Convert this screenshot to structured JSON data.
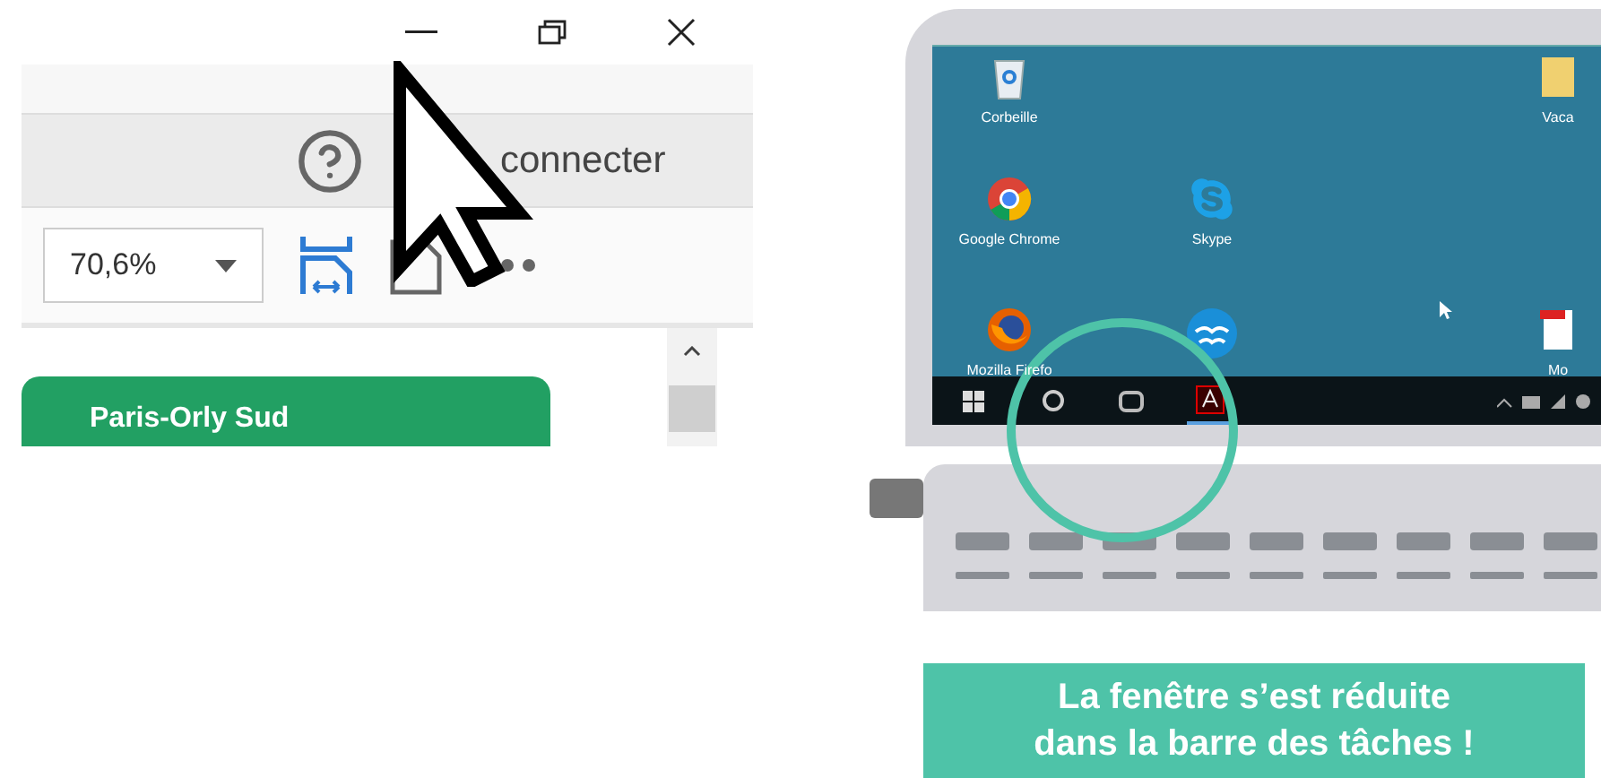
{
  "app_window": {
    "connect_text": "connecter",
    "zoom_select": {
      "value": "70,6%"
    },
    "card_title": "Paris-Orly Sud"
  },
  "laptop": {
    "desktop_icons": [
      {
        "kind": "recycle",
        "label": "Corbeille"
      },
      {
        "kind": "folder",
        "label": "Vaca"
      },
      {
        "kind": "chrome",
        "label": "Google Chrome"
      },
      {
        "kind": "skype",
        "label": "Skype"
      },
      {
        "kind": "firefox",
        "label": "Mozilla Firefo"
      },
      {
        "kind": "openoffice"
      },
      {
        "kind": "pdf",
        "label": "Mo"
      }
    ],
    "taskbar_items": [
      {
        "kind": "start",
        "selected": false
      },
      {
        "kind": "search",
        "selected": false
      },
      {
        "kind": "taskview",
        "selected": false
      },
      {
        "kind": "acrobat",
        "selected": true
      }
    ]
  },
  "caption": {
    "lines": [
      "La fenêtre s’est réduite",
      "dans la barre des tâches !"
    ]
  }
}
